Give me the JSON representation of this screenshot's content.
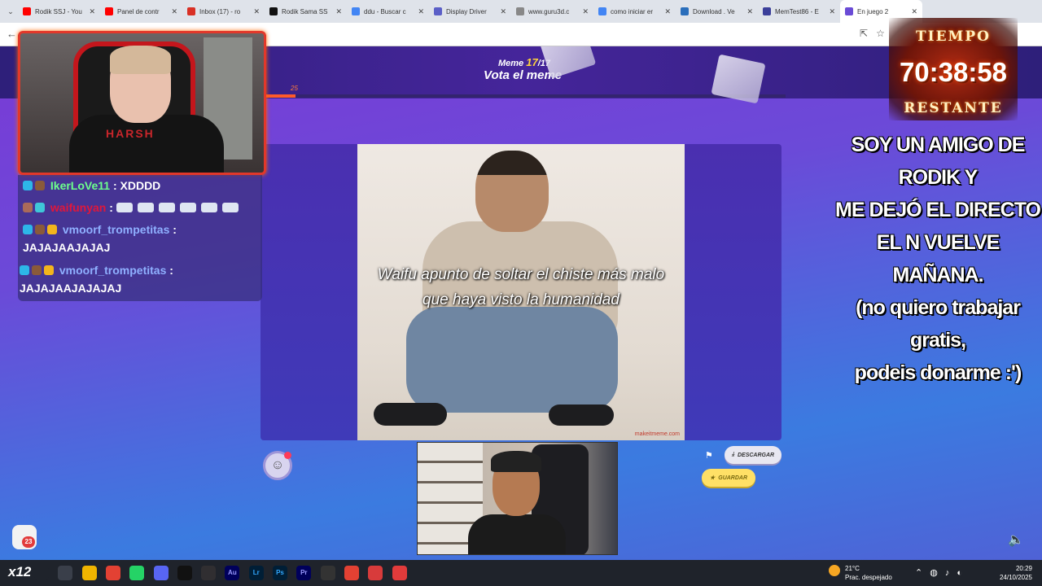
{
  "browser": {
    "tabs": [
      {
        "label": "Rodik SSJ - You",
        "favicon_color": "#ff0000"
      },
      {
        "label": "Panel de contr",
        "favicon_color": "#ff0000"
      },
      {
        "label": "Inbox (17) - ro",
        "favicon_color": "#d93025"
      },
      {
        "label": "Rodik Sama SS",
        "favicon_color": "#111111"
      },
      {
        "label": "ddu - Buscar c",
        "favicon_color": "#4285f4"
      },
      {
        "label": "Display Driver",
        "favicon_color": "#5b5fc7"
      },
      {
        "label": "www.guru3d.c",
        "favicon_color": "#888888"
      },
      {
        "label": "como iniciar er",
        "favicon_color": "#4285f4"
      },
      {
        "label": "Download . Ve",
        "favicon_color": "#2a6ebb"
      },
      {
        "label": "MemTest86 - E",
        "favicon_color": "#3b3f9a"
      },
      {
        "label": "En juego 2",
        "favicon_color": "#6a4bd6",
        "active": true
      }
    ]
  },
  "game": {
    "meme_label": "Meme",
    "meme_current": "17",
    "meme_total": "/17",
    "vote_title": "Vota el meme",
    "timer_small": "25",
    "progress_fraction": 0.06,
    "caption": "Waifu apunto de soltar el chiste más malo que haya visto la humanidad",
    "watermark": "makeitmeme.com",
    "download_label": "DESCARGAR",
    "save_label": "GUARDAR",
    "emoji": "☺",
    "flag_icon": "flag-icon",
    "volume_icon": "volume-icon"
  },
  "webcam": {
    "shirt_text": "HARSH"
  },
  "chat": {
    "messages": [
      {
        "user": "IkerLoVe11",
        "user_color": "#6cff8c",
        "sep": " : ",
        "text": "XDDDD"
      },
      {
        "user": "waifunyan",
        "user_color": "#e0173b",
        "sep": " : ",
        "text": ""
      },
      {
        "user": "vmoorf_trompetitas",
        "user_color": "#8fb0ff",
        "sep": " :",
        "text": "JAJAJAAJAJAJ"
      },
      {
        "user": "vmoorf_trompetitas",
        "user_color": "#8fb0ff",
        "sep": " :",
        "text": "JAJAJAAJAJAJAJ"
      }
    ]
  },
  "overlay": {
    "timer_top": "TIEMPO",
    "timer_value": "70:38:58",
    "timer_bottom": "RESTANTE",
    "message_lines": [
      "SOY UN AMIGO DE RODIK Y",
      "ME DEJÓ EL DIRECTO",
      "EL N VUELVE MAÑANA.",
      "(no quiero trabajar gratis,",
      "podeis donarme :')"
    ]
  },
  "notification": {
    "count": "23"
  },
  "taskbar": {
    "logo": "x12",
    "apps": [
      "search-icon",
      "taskview-icon",
      "explorer-icon",
      "chrome-icon",
      "whatsapp-icon",
      "discord-icon",
      "tiktok-icon",
      "obs-icon",
      "audition-icon",
      "lightroom-icon",
      "photoshop-icon",
      "premiere-icon",
      "terminal-icon",
      "chrome-dev-icon",
      "app-red-icon",
      "app-red2-icon"
    ],
    "app_labels": [
      "",
      "",
      "",
      "",
      "",
      "",
      "",
      "",
      "Au",
      "Lr",
      "Ps",
      "Pr",
      "",
      "",
      "",
      ""
    ],
    "weather_temp": "21°C",
    "weather_desc": "Prac. despejado",
    "time": "20:29",
    "date": "24/10/2025"
  }
}
